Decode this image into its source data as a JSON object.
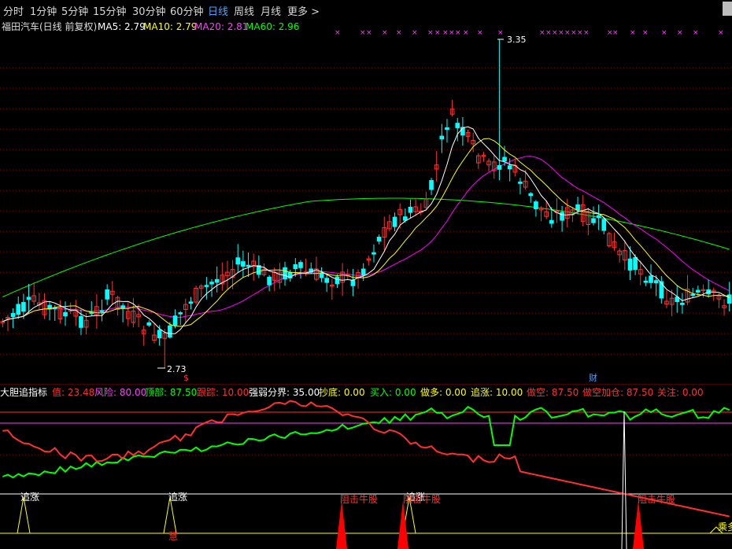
{
  "toolbar": {
    "periods": [
      "分时",
      "1分钟",
      "5分钟",
      "15分钟",
      "30分钟",
      "60分钟",
      "日线",
      "周线",
      "月线",
      "更多 >"
    ],
    "active": "日线"
  },
  "main_header": {
    "stock": "福田汽车(日线 前复权)",
    "ma": [
      {
        "label": "MA5: 2.79",
        "color": "#ffffff"
      },
      {
        "label": "MA10: 2.79",
        "color": "#ffff00"
      },
      {
        "label": "MA20: 2.81",
        "color": "#ff00ff"
      },
      {
        "label": "MA60: 2.96",
        "color": "#00ff00"
      }
    ]
  },
  "price_annotations": {
    "high": "3.35",
    "low": "2.73",
    "event_marker": "财",
    "event_marker_2": "$"
  },
  "indicator_header": {
    "title": "大胆追指标",
    "items": [
      {
        "label": "值: 23.48",
        "color": "#ff3030"
      },
      {
        "label": "风险: 80.00",
        "color": "#ff40ff"
      },
      {
        "label": "顶部: 87.50",
        "color": "#00ff00"
      },
      {
        "label": "跟踪: 10.00",
        "color": "#ff3030"
      },
      {
        "label": "强弱分界: 35.00",
        "color": "#ffffff"
      },
      {
        "label": "抄底: 0.00",
        "color": "#ffff00"
      },
      {
        "label": "买入: 0.00",
        "color": "#00ff00"
      },
      {
        "label": "做多: 0.00",
        "color": "#ffff00"
      },
      {
        "label": "追涨: 10.00",
        "color": "#ffff00"
      },
      {
        "label": "做空: 87.50",
        "color": "#ff3030"
      },
      {
        "label": "做空加仓: 87.50",
        "color": "#ff3030"
      },
      {
        "label": "关注: 0.00",
        "color": "#ff3030"
      }
    ]
  },
  "signals": {
    "zhuizhang": "追涨",
    "zuji": "阻击牛股",
    "maxiao": "慧",
    "tiaoshi": "乘多"
  },
  "colors": {
    "up": "#ff3232",
    "down": "#00ffff",
    "ma5": "#ffffff",
    "ma10": "#ffff00",
    "ma20": "#ff00ff",
    "ma60": "#00ff00",
    "grid": "#8b0000",
    "bg": "#000000"
  },
  "chart_data": {
    "type": "candlestick",
    "days": 140,
    "price_range": [
      2.73,
      3.35
    ],
    "ma_values_last": {
      "MA5": 2.79,
      "MA10": 2.79,
      "MA20": 2.81,
      "MA60": 2.96
    },
    "indicator_levels": {
      "风险": 80.0,
      "顶部": 87.5,
      "跟踪": 10.0,
      "强弱分界": 35.0
    }
  }
}
